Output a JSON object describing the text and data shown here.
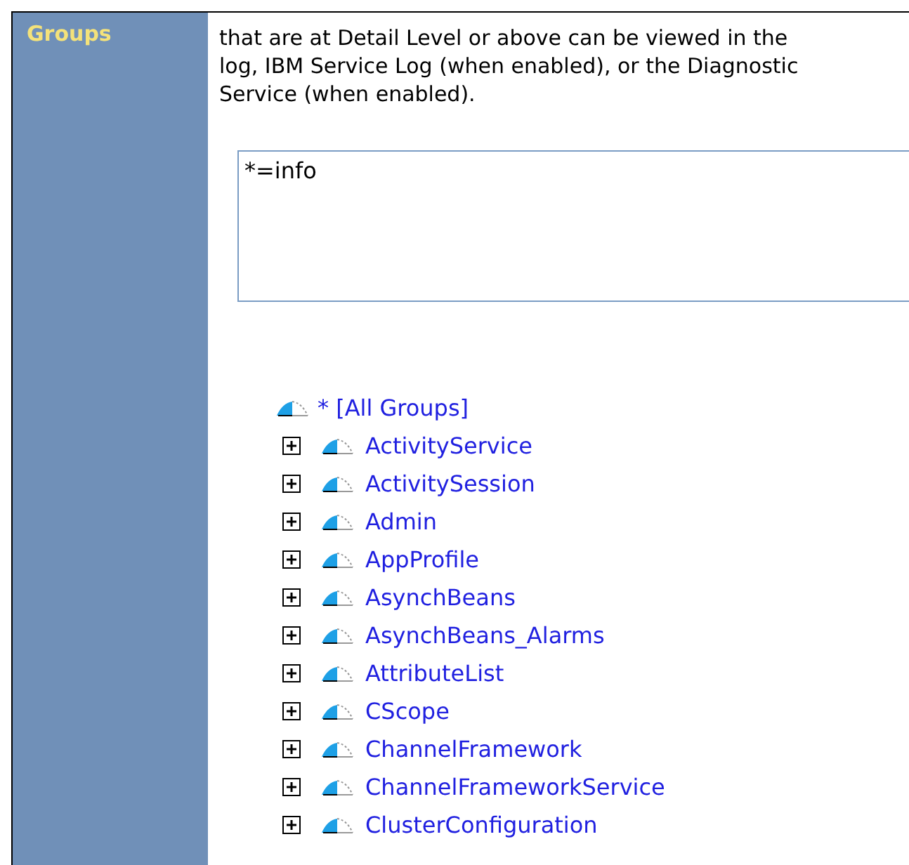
{
  "sidebar": {
    "title": "Groups"
  },
  "description": [
    "that are at Detail Level or above can be viewed in the",
    "log, IBM Service Log (when enabled), or the Diagnostic",
    "Service (when enabled)."
  ],
  "trace_spec": {
    "value": "*=info"
  },
  "tree": {
    "label": "* [All Groups]",
    "children": [
      {
        "label": "ActivityService",
        "expanded": false
      },
      {
        "label": "ActivitySession",
        "expanded": false
      },
      {
        "label": "Admin",
        "expanded": false
      },
      {
        "label": "AppProfile",
        "expanded": false
      },
      {
        "label": "AsynchBeans",
        "expanded": false
      },
      {
        "label": "AsynchBeans_Alarms",
        "expanded": false
      },
      {
        "label": "AttributeList",
        "expanded": false
      },
      {
        "label": "CScope",
        "expanded": false
      },
      {
        "label": "ChannelFramework",
        "expanded": false
      },
      {
        "label": "ChannelFrameworkService",
        "expanded": false
      },
      {
        "label": "ClusterConfiguration",
        "expanded": false
      }
    ]
  }
}
